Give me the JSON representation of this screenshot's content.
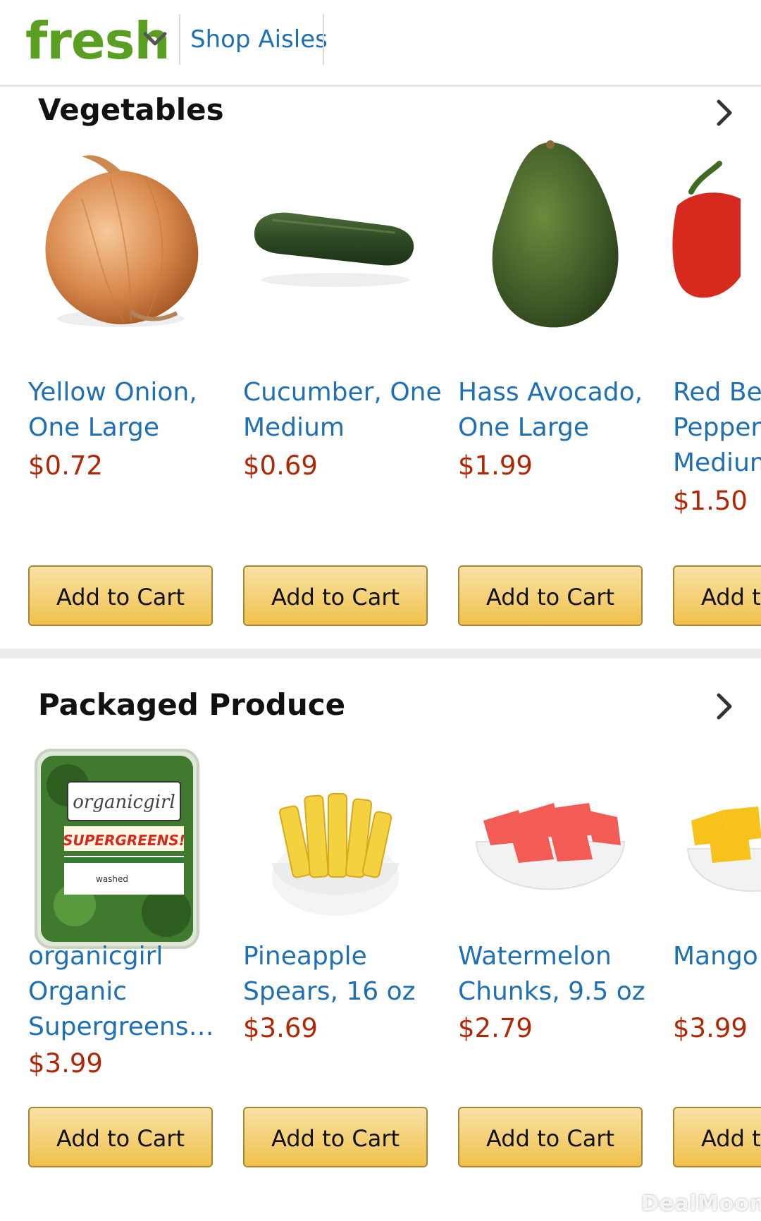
{
  "header": {
    "logo": "fresh",
    "shop_aisles": "Shop Aisles"
  },
  "sections": [
    {
      "title": "Vegetables",
      "products": [
        {
          "name": "Yellow Onion, One Large",
          "price": "$0.72",
          "button": "Add to Cart"
        },
        {
          "name": "Cucumber, One Medium",
          "price": "$0.69",
          "button": "Add to Cart"
        },
        {
          "name": "Hass Avocado, One Large",
          "price": "$1.99",
          "button": "Add to Cart"
        },
        {
          "name": "Red Bell Pepper, Medium",
          "price": "$1.50",
          "button": "Add to Cart"
        }
      ]
    },
    {
      "title": "Packaged Produce",
      "products": [
        {
          "name": "organicgirl Organic Supergreens…",
          "price": "$3.99",
          "button": "Add to Cart"
        },
        {
          "name": "Pineapple Spears, 16 oz",
          "price": "$3.69",
          "button": "Add to Cart"
        },
        {
          "name": "Watermelon Chunks, 9.5 oz",
          "price": "$2.79",
          "button": "Add to Cart"
        },
        {
          "name": "Mango Chunks",
          "price": "$3.99",
          "button": "Add to Cart"
        }
      ]
    }
  ],
  "package_label": {
    "brand": "organicgirl",
    "product": "SUPERGREENS!",
    "note": "washed"
  },
  "watermark": "DealMoon",
  "colors": {
    "brand_green": "#5a9e22",
    "link_blue": "#1f6fb4",
    "price_red": "#b12704",
    "button_yellow": "#f0c14b"
  }
}
